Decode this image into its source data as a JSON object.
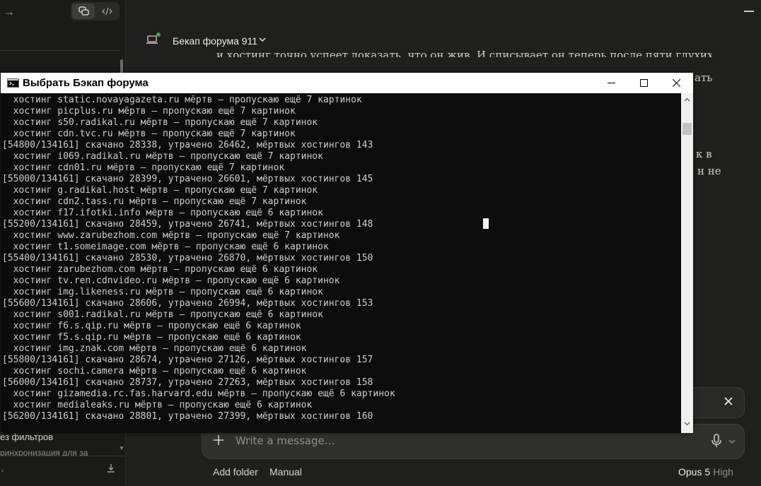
{
  "app": {
    "project_name": "Бекап форума 911",
    "chat_lines": [
      "и хостинг точно успеет доказать, что он жив. И списывает он теперь после пяти глухих отказов",
      "ать"
    ],
    "chat_fragments": [
      "к в",
      "н не"
    ],
    "composer_placeholder": "Write a message…",
    "add_folder_label": "Add folder",
    "manual_label": "Manual",
    "model_name": "Opus 5",
    "model_level": "High"
  },
  "sidebar": {
    "filter_label": "ез фильтров",
    "cut_text": "ринхронизация для за"
  },
  "console": {
    "title": "Выбрать Бэкап форума",
    "scrollbar_fraction": 0.96,
    "lines": [
      "  хостинг static.novayagazeta.ru мёртв — пропускаю ещё 7 картинок",
      "  хостинг picplus.ru мёртв — пропускаю ещё 7 картинок",
      "  хостинг s50.radikal.ru мёртв — пропускаю ещё 7 картинок",
      "  хостинг cdn.tvc.ru мёртв — пропускаю ещё 7 картинок",
      "[54800/134161] скачано 28338, утрачено 26462, мёртвых хостингов 143",
      "  хостинг i069.radikal.ru мёртв — пропускаю ещё 7 картинок",
      "  хостинг cdn01.ru мёртв — пропускаю ещё 7 картинок",
      "[55000/134161] скачано 28399, утрачено 26601, мёртвых хостингов 145",
      "  хостинг g.radikal.host мёртв — пропускаю ещё 7 картинок",
      "  хостинг cdn2.tass.ru мёртв — пропускаю ещё 7 картинок",
      "  хостинг f17.ifotki.info мёртв — пропускаю ещё 6 картинок",
      "[55200/134161] скачано 28459, утрачено 26741, мёртвых хостингов 148",
      "  хостинг www.zarubezhom.com мёртв — пропускаю ещё 7 картинок",
      "  хостинг t1.someimage.com мёртв — пропускаю ещё 6 картинок",
      "[55400/134161] скачано 28530, утрачено 26870, мёртвых хостингов 150",
      "  хостинг zarubezhom.com мёртв — пропускаю ещё 6 картинок",
      "  хостинг tv.ren.cdnvideo.ru мёртв — пропускаю ещё 6 картинок",
      "  хостинг img.likeness.ru мёртв — пропускаю ещё 6 картинок",
      "[55600/134161] скачано 28606, утрачено 26994, мёртвых хостингов 153",
      "  хостинг s001.radikal.ru мёртв — пропускаю ещё 6 картинок",
      "  хостинг f6.s.qip.ru мёртв — пропускаю ещё 6 картинок",
      "  хостинг f5.s.qip.ru мёртв — пропускаю ещё 6 картинок",
      "  хостинг img.znak.com мёртв — пропускаю ещё 6 картинок",
      "[55800/134161] скачано 28674, утрачено 27126, мёртвых хостингов 157",
      "  хостинг sochi.camera мёртв — пропускаю ещё 6 картинок",
      "[56000/134161] скачано 28737, утрачено 27263, мёртвых хостингов 158",
      "  хостинг gizamedia.rc.fas.harvard.edu мёртв — пропускаю ещё 6 картинок",
      "  хостинг medialeaks.ru мёртв — пропускаю ещё 6 картинок",
      "[56200/134161] скачано 28801, утрачено 27399, мёртвых хостингов 160"
    ]
  },
  "icons": {
    "sidebar_expand": "arrow-right-icon",
    "chat_mode": "chat-bubbles-icon",
    "code_mode": "code-icon",
    "environment": "laptop-icon",
    "dropdown": "chevron-down-icon",
    "dismiss": "close-icon",
    "attach": "plus-icon",
    "voice": "microphone-icon",
    "download": "download-icon",
    "terminal": "terminal-icon"
  },
  "colors": {
    "app_background": "#1f1f1e",
    "console_background": "#0c0c0c",
    "console_text": "#cccccc",
    "online_indicator": "#3aa55c"
  }
}
